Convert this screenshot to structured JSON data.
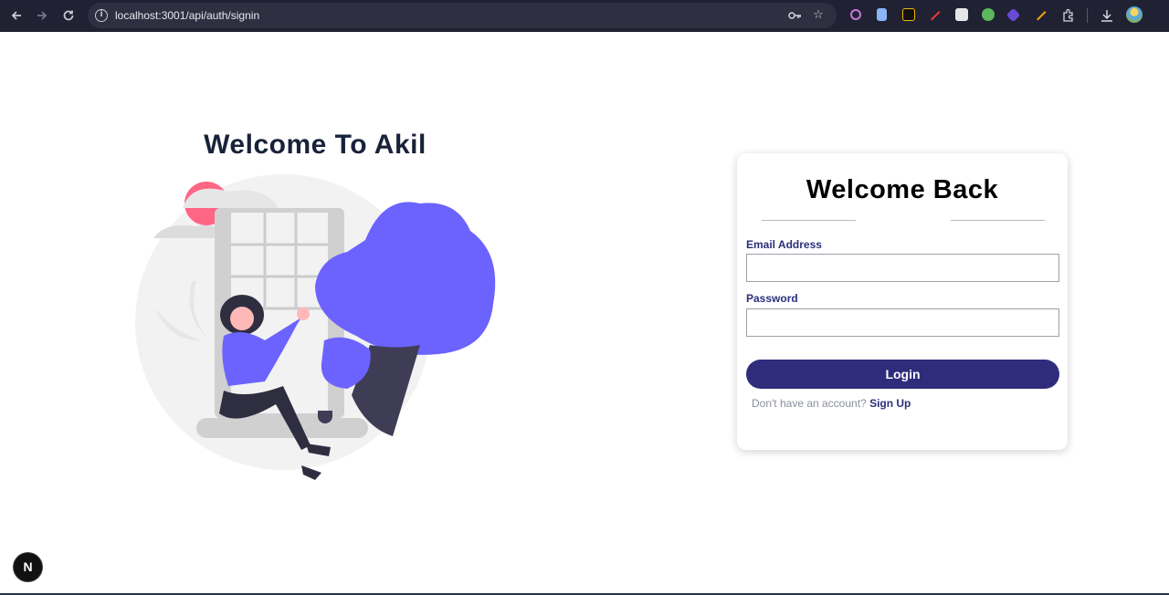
{
  "browser": {
    "url": "localhost:3001/api/auth/signin",
    "icons": [
      "back-icon",
      "forward-icon",
      "reload-icon",
      "info-icon",
      "key-icon",
      "star-icon",
      "extension-icons",
      "puzzle-icon",
      "download-icon",
      "profile-avatar"
    ]
  },
  "page": {
    "left_title": "Welcome To Akil",
    "card": {
      "title": "Welcome Back",
      "email_label": "Email Address",
      "email_value": "",
      "password_label": "Password",
      "password_value": "",
      "login_label": "Login",
      "signup_prompt": "Don't have an account?",
      "signup_link": "Sign Up"
    },
    "nextjs_badge": "N"
  },
  "colors": {
    "chrome_bg": "#202233",
    "button_primary": "#2f2c7b",
    "label_color": "#2b2f7a",
    "title_color": "#18233a",
    "illustration_accent": "#6c63ff",
    "illustration_sun": "#ff6584"
  }
}
